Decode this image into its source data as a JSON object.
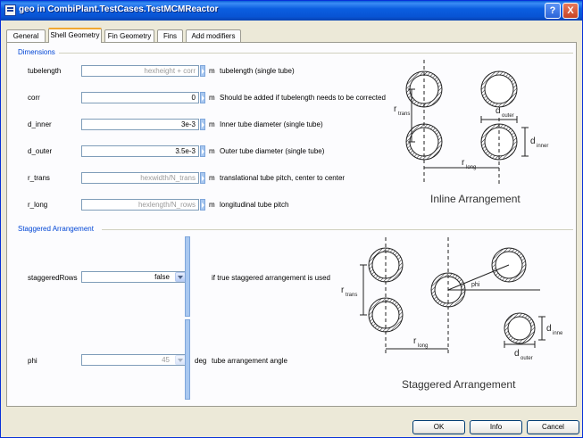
{
  "window": {
    "title": "geo in CombiPlant.TestCases.TestMCMReactor",
    "help_label": "?",
    "close_label": "X"
  },
  "tabs": [
    "General",
    "Shell Geometry",
    "Fin Geometry",
    "Fins",
    "Add modifiers"
  ],
  "active_tab": "Shell Geometry",
  "dimensions": {
    "title": "Dimensions",
    "params": [
      {
        "name": "tubelength",
        "value": "hexheight + corr",
        "placeholder": true,
        "unit": "m",
        "description": "tubelength (single tube)"
      },
      {
        "name": "corr",
        "value": "0",
        "placeholder": false,
        "unit": "m",
        "description": "Should be added if tubelength needs to be corrected"
      },
      {
        "name": "d_inner",
        "value": "3e-3",
        "placeholder": false,
        "unit": "m",
        "description": "Inner tube diameter (single tube)"
      },
      {
        "name": "d_outer",
        "value": "3.5e-3",
        "placeholder": false,
        "unit": "m",
        "description": "Outer tube diameter (single tube)"
      },
      {
        "name": "r_trans",
        "value": "hexwidth/N_trans",
        "placeholder": true,
        "unit": "m",
        "description": "translational tube pitch, center to center"
      },
      {
        "name": "r_long",
        "value": "hexlength/N_rows",
        "placeholder": true,
        "unit": "m",
        "description": "longitudinal tube pitch"
      }
    ],
    "diagram": {
      "caption": "Inline Arrangement",
      "r_trans_label": "r",
      "r_trans_sub": "trans",
      "r_long_label": "r",
      "r_long_sub": "long",
      "d_outer_label": "d",
      "d_outer_sub": "outer",
      "d_inner_label": "d",
      "d_inner_sub": "inner"
    }
  },
  "staggered": {
    "title": "Staggered Arrangement",
    "params": [
      {
        "name": "staggeredRows",
        "value": "false",
        "unit": "",
        "description": "if true staggered arrangement is used"
      },
      {
        "name": "phi",
        "value": "45",
        "unit": "deg",
        "description": "tube arrangement angle"
      }
    ],
    "diagram": {
      "caption": "Staggered Arrangement",
      "phi_label": "phi",
      "r_trans_label": "r",
      "r_trans_sub": "trans",
      "r_long_label": "r",
      "r_long_sub": "long",
      "d_inner_label": "d",
      "d_inner_sub": "inner",
      "d_outer_label": "d",
      "d_outer_sub": "outer"
    }
  },
  "buttons": {
    "ok": "OK",
    "info": "Info",
    "cancel": "Cancel"
  },
  "colors": {
    "titlebar": "#0b5ee0",
    "group_title": "#0046d5",
    "active_tab_accent": "#f0a830"
  }
}
